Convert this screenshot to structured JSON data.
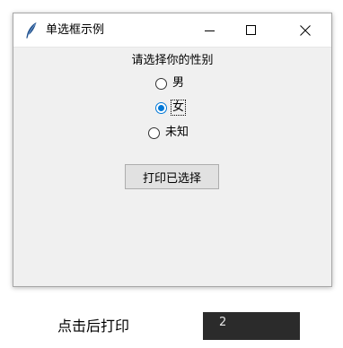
{
  "window": {
    "title": "单选框示例",
    "icon": "feather-icon",
    "controls": {
      "minimize": "minimize-icon",
      "maximize": "maximize-icon",
      "close": "close-icon"
    }
  },
  "form": {
    "prompt": "请选择你的性别",
    "options": [
      {
        "label": "男",
        "checked": false
      },
      {
        "label": "女",
        "checked": true
      },
      {
        "label": "未知",
        "checked": false
      }
    ],
    "print_button_label": "打印已选择"
  },
  "caption": "点击后打印",
  "output": {
    "value": "2"
  },
  "colors": {
    "accent": "#0078d7",
    "window_bg": "#f0f0f0",
    "output_bg": "#2b2b2b"
  }
}
